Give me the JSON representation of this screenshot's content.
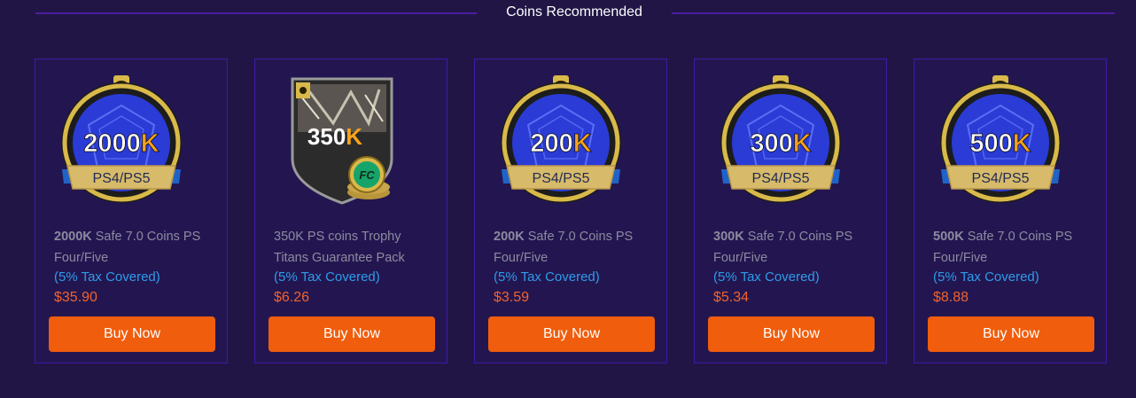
{
  "section": {
    "title": "Coins Recommended"
  },
  "colors": {
    "accent": "#f05d0c",
    "price": "#f0622c",
    "tax": "#2f9bea",
    "border": "#3f1aa6"
  },
  "cards": [
    {
      "badge_amount": "2000",
      "badge_suffix": "K",
      "badge_platform": "PS4/PS5",
      "desc_bold": "2000K",
      "desc_text": " Safe 7.0 Coins PS Four/Five",
      "tax": "(5% Tax Covered)",
      "price": "$35.90",
      "button": "Buy Now"
    },
    {
      "badge_amount": "350",
      "badge_suffix": "K",
      "desc_bold": "",
      "desc_text": "350K PS coins Trophy Titans Guarantee Pack",
      "tax": "(5% Tax Covered)",
      "price": "$6.26",
      "button": "Buy Now"
    },
    {
      "badge_amount": "200",
      "badge_suffix": "K",
      "badge_platform": "PS4/PS5",
      "desc_bold": "200K",
      "desc_text": " Safe 7.0 Coins PS Four/Five",
      "tax": "(5% Tax Covered)",
      "price": "$3.59",
      "button": "Buy Now"
    },
    {
      "badge_amount": "300",
      "badge_suffix": "K",
      "badge_platform": "PS4/PS5",
      "desc_bold": "300K",
      "desc_text": " Safe 7.0 Coins PS Four/Five",
      "tax": "(5% Tax Covered)",
      "price": "$5.34",
      "button": "Buy Now"
    },
    {
      "badge_amount": "500",
      "badge_suffix": "K",
      "badge_platform": "PS4/PS5",
      "desc_bold": "500K",
      "desc_text": " Safe 7.0 Coins PS Four/Five",
      "tax": "(5% Tax Covered)",
      "price": "$8.88",
      "button": "Buy Now"
    }
  ]
}
